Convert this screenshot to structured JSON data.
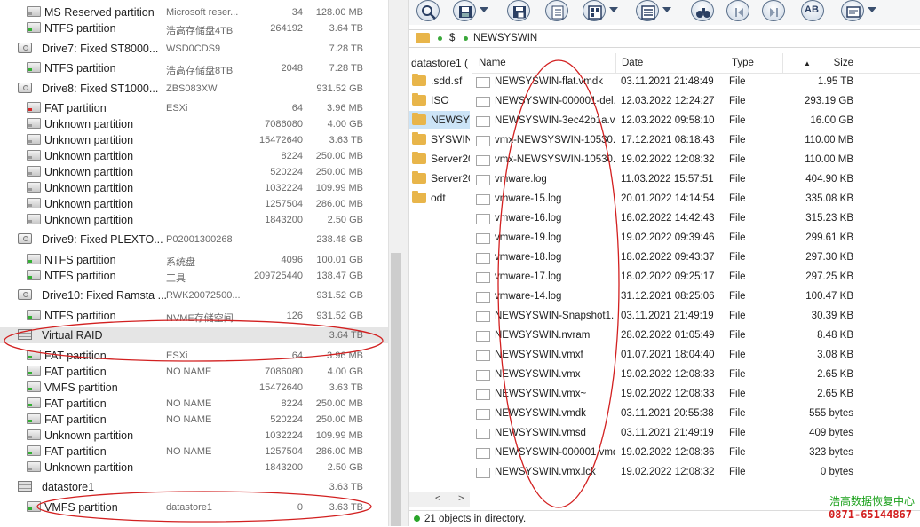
{
  "left_panel": {
    "rows": [
      {
        "kind": "part",
        "icon": "gray",
        "name": "MS Reserved partition",
        "label": "Microsoft reser...",
        "start": "34",
        "size": "128.00 MB"
      },
      {
        "kind": "part",
        "icon": "green",
        "name": "NTFS partition",
        "label": "浩高存储盘4TB",
        "start": "264192",
        "size": "3.64 TB"
      },
      {
        "kind": "drive",
        "name": "Drive7: Fixed ST8000...",
        "label": "WSD0CDS9",
        "start": "",
        "size": "7.28 TB"
      },
      {
        "kind": "part",
        "icon": "green",
        "name": "NTFS partition",
        "label": "浩高存储盘8TB",
        "start": "2048",
        "size": "7.28 TB"
      },
      {
        "kind": "drive",
        "name": "Drive8: Fixed ST1000...",
        "label": "ZBS083XW",
        "start": "",
        "size": "931.52 GB"
      },
      {
        "kind": "part",
        "icon": "red",
        "name": "FAT partition",
        "label": "ESXi",
        "start": "64",
        "size": "3.96 MB"
      },
      {
        "kind": "part",
        "icon": "gray",
        "name": "Unknown partition",
        "label": "",
        "start": "7086080",
        "size": "4.00 GB"
      },
      {
        "kind": "part",
        "icon": "gray",
        "name": "Unknown partition",
        "label": "",
        "start": "15472640",
        "size": "3.63 TB"
      },
      {
        "kind": "part",
        "icon": "gray",
        "name": "Unknown partition",
        "label": "",
        "start": "8224",
        "size": "250.00 MB"
      },
      {
        "kind": "part",
        "icon": "gray",
        "name": "Unknown partition",
        "label": "",
        "start": "520224",
        "size": "250.00 MB"
      },
      {
        "kind": "part",
        "icon": "gray",
        "name": "Unknown partition",
        "label": "",
        "start": "1032224",
        "size": "109.99 MB"
      },
      {
        "kind": "part",
        "icon": "gray",
        "name": "Unknown partition",
        "label": "",
        "start": "1257504",
        "size": "286.00 MB"
      },
      {
        "kind": "part",
        "icon": "gray",
        "name": "Unknown partition",
        "label": "",
        "start": "1843200",
        "size": "2.50 GB"
      },
      {
        "kind": "drive",
        "name": "Drive9: Fixed PLEXTO...",
        "label": "P02001300268",
        "start": "",
        "size": "238.48 GB"
      },
      {
        "kind": "part",
        "icon": "green",
        "name": "NTFS partition",
        "label": "系统盘",
        "start": "4096",
        "size": "100.01 GB"
      },
      {
        "kind": "part",
        "icon": "green",
        "name": "NTFS partition",
        "label": "工具",
        "start": "209725440",
        "size": "138.47 GB"
      },
      {
        "kind": "drive",
        "name": "Drive10: Fixed Ramsta ...",
        "label": "RWK20072500...",
        "start": "",
        "size": "931.52 GB"
      },
      {
        "kind": "part",
        "icon": "green",
        "name": "NTFS partition",
        "label": "NVME存储空间",
        "start": "126",
        "size": "931.52 GB"
      },
      {
        "kind": "raid",
        "name": "Virtual RAID",
        "label": "",
        "start": "",
        "size": "3.64 TB",
        "selected": true
      },
      {
        "kind": "part",
        "icon": "green",
        "name": "FAT partition",
        "label": "ESXi",
        "start": "64",
        "size": "3.96 MB"
      },
      {
        "kind": "part",
        "icon": "green",
        "name": "FAT partition",
        "label": "NO NAME",
        "start": "7086080",
        "size": "4.00 GB"
      },
      {
        "kind": "part",
        "icon": "green",
        "name": "VMFS partition",
        "label": "",
        "start": "15472640",
        "size": "3.63 TB"
      },
      {
        "kind": "part",
        "icon": "green",
        "name": "FAT partition",
        "label": "NO NAME",
        "start": "8224",
        "size": "250.00 MB"
      },
      {
        "kind": "part",
        "icon": "green",
        "name": "FAT partition",
        "label": "NO NAME",
        "start": "520224",
        "size": "250.00 MB"
      },
      {
        "kind": "part",
        "icon": "gray",
        "name": "Unknown partition",
        "label": "",
        "start": "1032224",
        "size": "109.99 MB"
      },
      {
        "kind": "part",
        "icon": "green",
        "name": "FAT partition",
        "label": "NO NAME",
        "start": "1257504",
        "size": "286.00 MB"
      },
      {
        "kind": "part",
        "icon": "gray",
        "name": "Unknown partition",
        "label": "",
        "start": "1843200",
        "size": "2.50 GB"
      },
      {
        "kind": "raid",
        "name": "datastore1",
        "label": "",
        "start": "",
        "size": "3.63 TB"
      },
      {
        "kind": "part",
        "icon": "green",
        "name": "VMFS partition",
        "label": "datastore1",
        "start": "0",
        "size": "3.63 TB"
      }
    ]
  },
  "toolbar": {
    "buttons": [
      {
        "name": "search-button",
        "icon": "search-icon",
        "dropdown": false
      },
      {
        "name": "save-button",
        "icon": "save-icon",
        "dropdown": true
      },
      {
        "name": "save-region-button",
        "icon": "save-region-icon",
        "dropdown": false
      },
      {
        "name": "task-list-button",
        "icon": "checklist-icon",
        "dropdown": false
      },
      {
        "name": "view-button",
        "icon": "view-grid-icon",
        "dropdown": true
      },
      {
        "name": "list-view-button",
        "icon": "list-icon",
        "dropdown": true
      },
      {
        "name": "find-button",
        "icon": "binoculars-icon",
        "dropdown": false
      },
      {
        "name": "back-button",
        "icon": "back-icon",
        "dropdown": false
      },
      {
        "name": "forward-button",
        "icon": "forward-icon",
        "dropdown": false
      },
      {
        "name": "case-button",
        "icon": "text-case-icon",
        "dropdown": false
      },
      {
        "name": "display-button",
        "icon": "display-icon",
        "dropdown": true
      }
    ],
    "case_text": "AB"
  },
  "path_bar": {
    "segments": [
      "$",
      "NEWSYSWIN"
    ]
  },
  "folder_tree": {
    "items": [
      {
        "name": "datastore1 (",
        "folder": false
      },
      {
        "name": ".sdd.sf",
        "folder": true
      },
      {
        "name": "ISO",
        "folder": true
      },
      {
        "name": "NEWSYSW",
        "folder": true,
        "selected": true
      },
      {
        "name": "SYSWIN",
        "folder": true
      },
      {
        "name": "Server20",
        "folder": true
      },
      {
        "name": "Server20",
        "folder": true
      },
      {
        "name": "odt",
        "folder": true
      }
    ]
  },
  "file_list": {
    "columns": {
      "name": "Name",
      "date": "Date",
      "type": "Type",
      "size": "Size"
    },
    "files": [
      {
        "name": "NEWSYSWIN-flat.vmdk",
        "date": "03.11.2021 21:48:49",
        "type": "File",
        "size": "1.95 TB"
      },
      {
        "name": "NEWSYSWIN-000001-del...",
        "date": "12.03.2022 12:24:27",
        "type": "File",
        "size": "293.19 GB"
      },
      {
        "name": "NEWSYSWIN-3ec42b1a.v...",
        "date": "12.03.2022 09:58:10",
        "type": "File",
        "size": "16.00 GB"
      },
      {
        "name": "vmx-NEWSYSWIN-10530...",
        "date": "17.12.2021 08:18:43",
        "type": "File",
        "size": "110.00 MB"
      },
      {
        "name": "vmx-NEWSYSWIN-10530...",
        "date": "19.02.2022 12:08:32",
        "type": "File",
        "size": "110.00 MB"
      },
      {
        "name": "vmware.log",
        "date": "11.03.2022 15:57:51",
        "type": "File",
        "size": "404.90 KB"
      },
      {
        "name": "vmware-15.log",
        "date": "20.01.2022 14:14:54",
        "type": "File",
        "size": "335.08 KB"
      },
      {
        "name": "vmware-16.log",
        "date": "16.02.2022 14:42:43",
        "type": "File",
        "size": "315.23 KB"
      },
      {
        "name": "vmware-19.log",
        "date": "19.02.2022 09:39:46",
        "type": "File",
        "size": "299.61 KB"
      },
      {
        "name": "vmware-18.log",
        "date": "18.02.2022 09:43:37",
        "type": "File",
        "size": "297.30 KB"
      },
      {
        "name": "vmware-17.log",
        "date": "18.02.2022 09:25:17",
        "type": "File",
        "size": "297.25 KB"
      },
      {
        "name": "vmware-14.log",
        "date": "31.12.2021 08:25:06",
        "type": "File",
        "size": "100.47 KB"
      },
      {
        "name": "NEWSYSWIN-Snapshot1....",
        "date": "03.11.2021 21:49:19",
        "type": "File",
        "size": "30.39 KB"
      },
      {
        "name": "NEWSYSWIN.nvram",
        "date": "28.02.2022 01:05:49",
        "type": "File",
        "size": "8.48 KB"
      },
      {
        "name": "NEWSYSWIN.vmxf",
        "date": "01.07.2021 18:04:40",
        "type": "File",
        "size": "3.08 KB"
      },
      {
        "name": "NEWSYSWIN.vmx",
        "date": "19.02.2022 12:08:33",
        "type": "File",
        "size": "2.65 KB"
      },
      {
        "name": "NEWSYSWIN.vmx~",
        "date": "19.02.2022 12:08:33",
        "type": "File",
        "size": "2.65 KB"
      },
      {
        "name": "NEWSYSWIN.vmdk",
        "date": "03.11.2021 20:55:38",
        "type": "File",
        "size": "555 bytes"
      },
      {
        "name": "NEWSYSWIN.vmsd",
        "date": "03.11.2021 21:49:19",
        "type": "File",
        "size": "409 bytes"
      },
      {
        "name": "NEWSYSWIN-000001.vmdk",
        "date": "19.02.2022 12:08:36",
        "type": "File",
        "size": "323 bytes"
      },
      {
        "name": "NEWSYSWIN.vmx.lck",
        "date": "19.02.2022 12:08:32",
        "type": "File",
        "size": "0 bytes"
      }
    ]
  },
  "status": {
    "text": "21 objects in directory."
  },
  "watermark": {
    "line1": "浩高数据恢复中心",
    "line2": "0871-65144867"
  },
  "colors": {
    "annotation": "#d22020",
    "ok": "#2aa52a",
    "folder": "#e8b54a"
  }
}
